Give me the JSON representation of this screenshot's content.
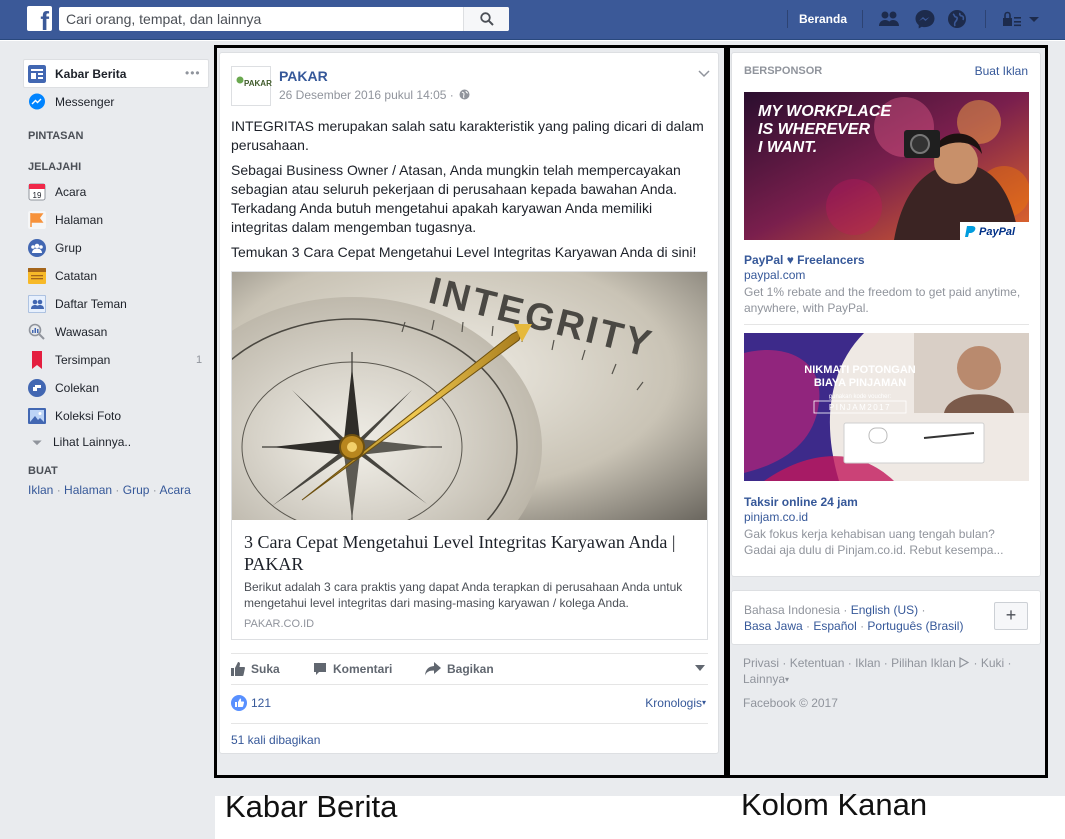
{
  "topbar": {
    "logo_letter": "f",
    "search_placeholder": "Cari orang, tempat, dan lainnya",
    "home_label": "Beranda"
  },
  "left_nav": {
    "main_items": [
      {
        "label": "Kabar Berita",
        "icon": "news-feed-icon",
        "more": "•••"
      },
      {
        "label": "Messenger",
        "icon": "messenger-icon"
      }
    ],
    "pintasan_header": "PINTASAN",
    "jelajahi_header": "JELAJAHI",
    "jelajahi_items": [
      {
        "label": "Acara",
        "icon": "calendar-icon",
        "icon_text": "19"
      },
      {
        "label": "Halaman",
        "icon": "flag-icon"
      },
      {
        "label": "Grup",
        "icon": "group-icon"
      },
      {
        "label": "Catatan",
        "icon": "notes-icon"
      },
      {
        "label": "Daftar Teman",
        "icon": "friend-list-icon"
      },
      {
        "label": "Wawasan",
        "icon": "insights-icon"
      },
      {
        "label": "Tersimpan",
        "icon": "saved-icon",
        "count": "1"
      },
      {
        "label": "Colekan",
        "icon": "poke-icon"
      },
      {
        "label": "Koleksi Foto",
        "icon": "photo-icon"
      }
    ],
    "see_more": "Lihat Lainnya..",
    "buat_header": "BUAT",
    "buat_links": [
      "Iklan",
      "Halaman",
      "Grup",
      "Acara"
    ],
    "buat_sep": " · "
  },
  "post": {
    "page_name": "PAKAR",
    "avatar_text": "PAKAR",
    "timestamp": "26 Desember 2016 pukul 14:05 ·",
    "paragraphs": [
      "INTEGRITAS merupakan salah satu karakteristik yang paling dicari di dalam perusahaan.",
      "Sebagai Business Owner / Atasan, Anda mungkin telah mempercayakan sebagian atau seluruh pekerjaan di perusahaan kepada bawahan Anda. Terkadang Anda butuh mengetahui apakah karyawan Anda memiliki integritas dalam mengemban tugasnya.",
      "Temukan 3 Cara Cepat Mengetahui Level Integritas Karyawan Anda di sini!"
    ],
    "image_word": "INTEGRITY",
    "link_title": "3 Cara Cepat Mengetahui Level Integritas Karyawan Anda | PAKAR",
    "link_desc": "Berikut adalah 3 cara praktis yang dapat Anda terapkan di perusahaan Anda untuk mengetahui level integritas dari masing-masing karyawan / kolega Anda.",
    "link_domain": "PAKAR.CO.ID",
    "actions": {
      "like": "Suka",
      "comment": "Komentari",
      "share": "Bagikan"
    },
    "like_count": "121",
    "sort_label": "Kronologis",
    "shares": "51 kali dibagikan"
  },
  "right_col": {
    "sponsor_header": "BERSPONSOR",
    "create_ad": "Buat Iklan",
    "ads": [
      {
        "image_headline": [
          "MY WORKPLACE",
          "IS WHEREVER",
          "I WANT."
        ],
        "brand": "PayPal",
        "title": "PayPal ♥ Freelancers",
        "domain": "paypal.com",
        "desc": "Get 1% rebate and the freedom to get paid anytime, anywhere, with PayPal."
      },
      {
        "image_headline": [
          "NIKMATI POTONGAN",
          "BIAYA PINJAMAN"
        ],
        "image_sub": "gunakan kode voucher:",
        "image_code": "PINJAM2017",
        "title": "Taksir online 24 jam",
        "domain": "pinjam.co.id",
        "desc": "Gak fokus kerja kehabisan uang tengah bulan? Gadai aja dulu di Pinjam.co.id. Rebut kesempa..."
      }
    ],
    "languages": {
      "current": "Bahasa Indonesia",
      "others": [
        "English (US)",
        "Basa Jawa",
        "Español",
        "Português (Brasil)"
      ],
      "add": "+"
    },
    "footer_links": [
      "Privasi",
      "Ketentuan",
      "Iklan",
      "Pilihan Iklan",
      "Kuki",
      "Lainnya"
    ],
    "copyright": "Facebook © 2017"
  },
  "captions": {
    "left": "Kabar Berita",
    "right": "Kolom Kanan"
  },
  "colors": {
    "brand_blue": "#3b5998",
    "link_blue": "#365899",
    "page_bg": "#e9ebee",
    "annotation_border": "#000000"
  }
}
